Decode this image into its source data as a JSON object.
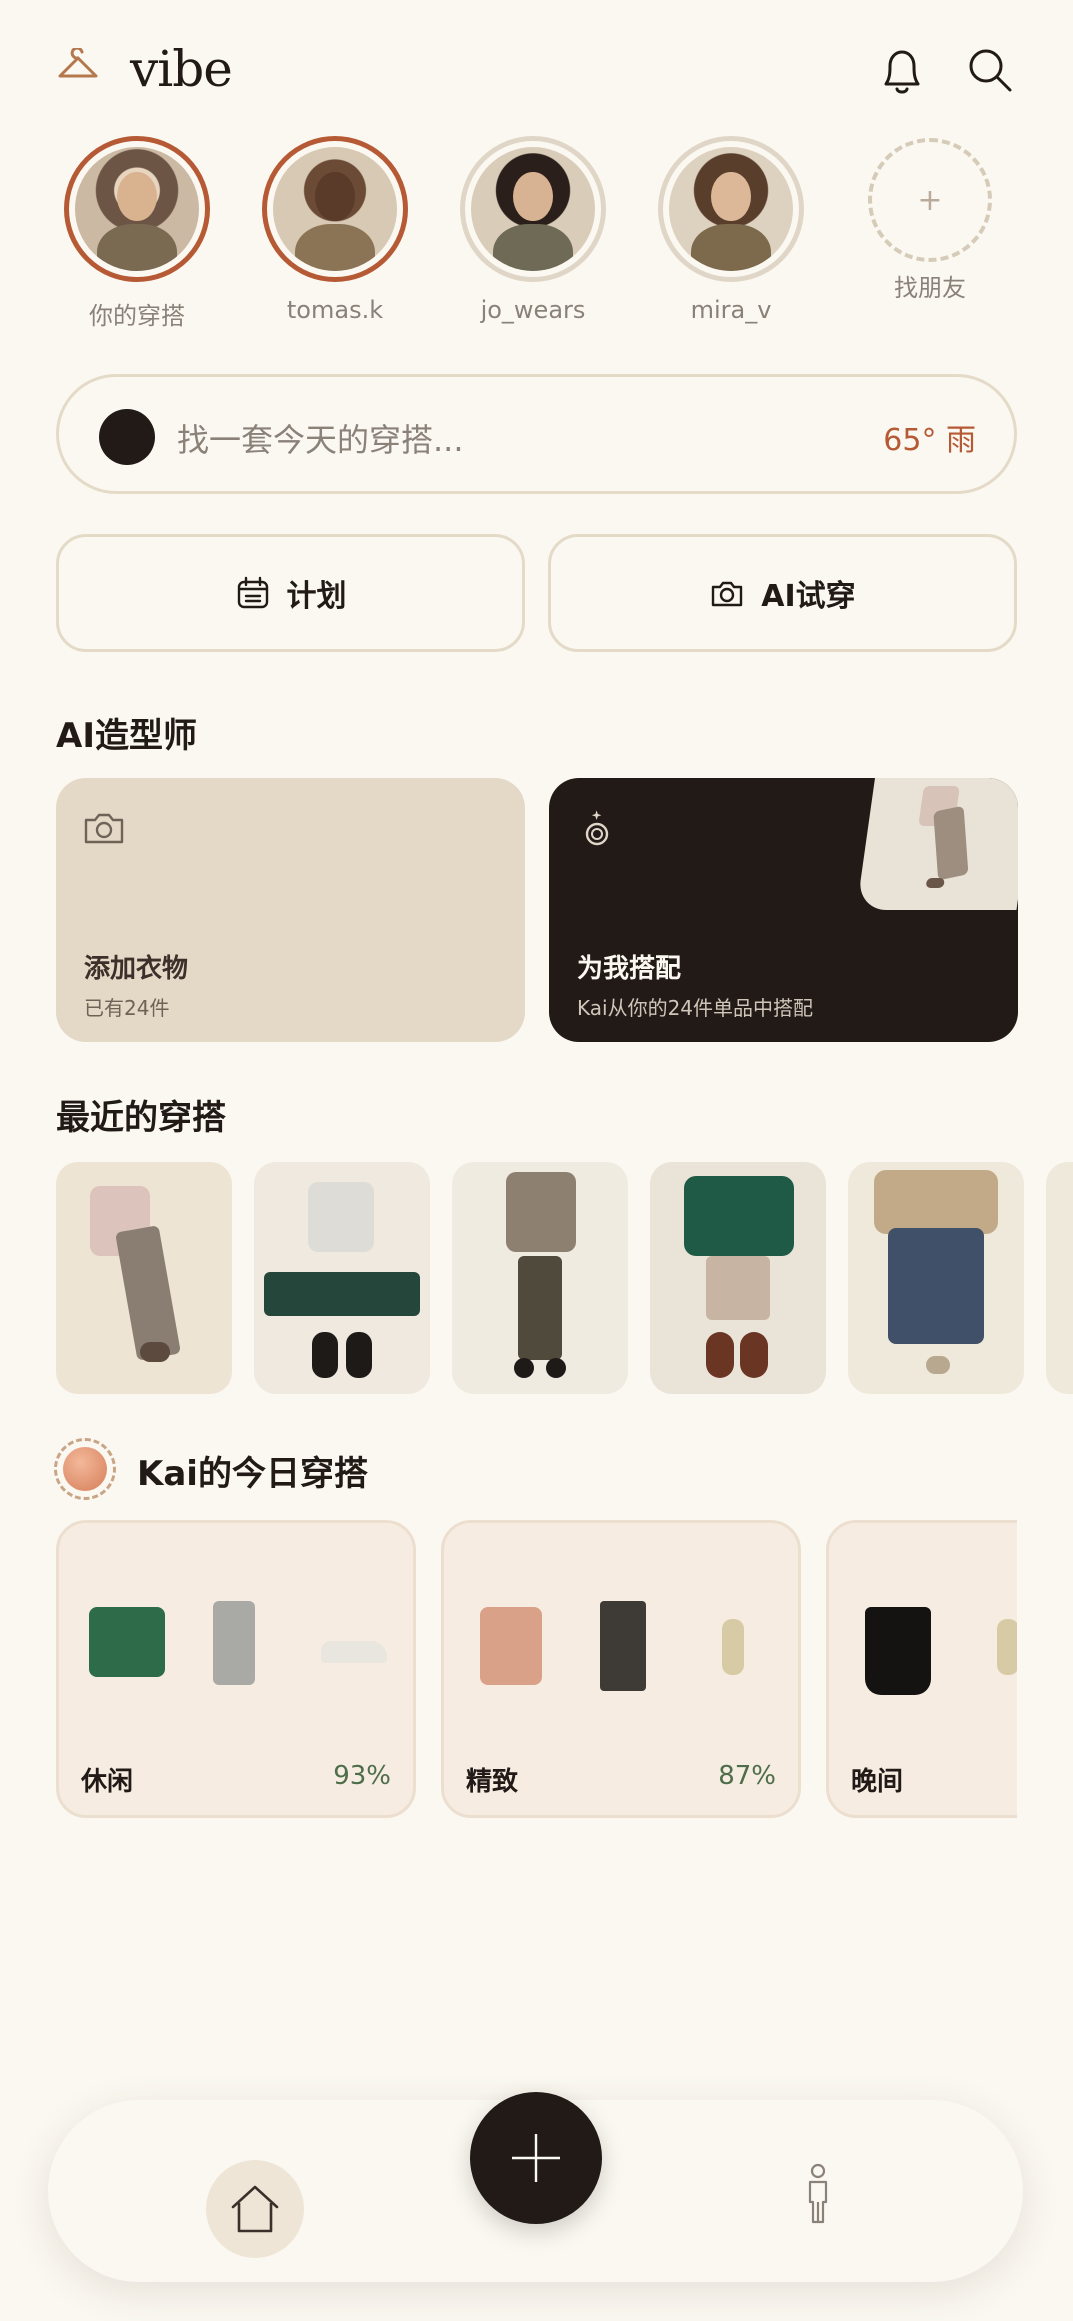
{
  "header": {
    "app_name": "vibe",
    "logo_icon": "hanger-icon",
    "notifications_icon": "bell-icon",
    "search_icon": "search-icon"
  },
  "stories": [
    {
      "label": "你的穿搭",
      "active": true
    },
    {
      "label": "tomas.k",
      "active": true
    },
    {
      "label": "jo_wears",
      "active": false
    },
    {
      "label": "mira_v",
      "active": false
    }
  ],
  "add_friend": {
    "symbol": "+",
    "label": "找朋友"
  },
  "search": {
    "placeholder": "找一套今天的穿搭...",
    "weather": "65° 雨"
  },
  "actions": {
    "plan_label": "计划",
    "plan_icon": "calendar-icon",
    "tryon_label": "AI试穿",
    "tryon_icon": "camera-icon"
  },
  "stylist": {
    "section_title": "AI造型师",
    "add_card": {
      "title": "添加衣物",
      "subtitle": "已有24件",
      "icon": "camera-icon"
    },
    "style_card": {
      "title": "为我搭配",
      "subtitle": "Kai从你的24件单品中搭配",
      "icon": "sparkle-ring-icon"
    }
  },
  "recent": {
    "section_title": "最近的穿搭",
    "count_visible": 5
  },
  "kai": {
    "section_title": "Kai的今日穿搭",
    "cards": [
      {
        "title": "休闲",
        "score": "93%"
      },
      {
        "title": "精致",
        "score": "87%"
      },
      {
        "title": "晚间",
        "score": ""
      }
    ]
  },
  "nav": {
    "home_icon": "home-icon",
    "add_icon": "plus-icon",
    "profile_icon": "person-icon"
  },
  "colors": {
    "background": "#fbf8f1",
    "accent": "#b55a34",
    "dark": "#211a17",
    "score_green": "#4e6e4b"
  }
}
